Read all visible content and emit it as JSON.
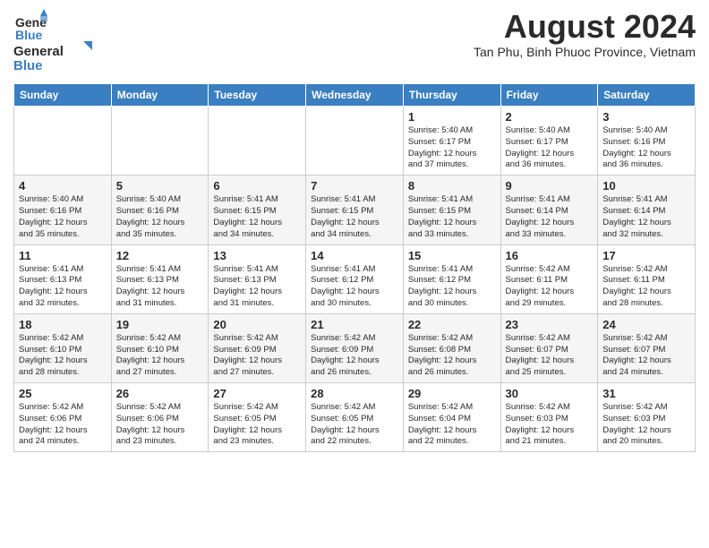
{
  "header": {
    "logo_line1": "General",
    "logo_line2": "Blue",
    "main_title": "August 2024",
    "subtitle": "Tan Phu, Binh Phuoc Province, Vietnam"
  },
  "calendar": {
    "days_of_week": [
      "Sunday",
      "Monday",
      "Tuesday",
      "Wednesday",
      "Thursday",
      "Friday",
      "Saturday"
    ],
    "weeks": [
      [
        {
          "day": "",
          "info": ""
        },
        {
          "day": "",
          "info": ""
        },
        {
          "day": "",
          "info": ""
        },
        {
          "day": "",
          "info": ""
        },
        {
          "day": "1",
          "info": "Sunrise: 5:40 AM\nSunset: 6:17 PM\nDaylight: 12 hours\nand 37 minutes."
        },
        {
          "day": "2",
          "info": "Sunrise: 5:40 AM\nSunset: 6:17 PM\nDaylight: 12 hours\nand 36 minutes."
        },
        {
          "day": "3",
          "info": "Sunrise: 5:40 AM\nSunset: 6:16 PM\nDaylight: 12 hours\nand 36 minutes."
        }
      ],
      [
        {
          "day": "4",
          "info": "Sunrise: 5:40 AM\nSunset: 6:16 PM\nDaylight: 12 hours\nand 35 minutes."
        },
        {
          "day": "5",
          "info": "Sunrise: 5:40 AM\nSunset: 6:16 PM\nDaylight: 12 hours\nand 35 minutes."
        },
        {
          "day": "6",
          "info": "Sunrise: 5:41 AM\nSunset: 6:15 PM\nDaylight: 12 hours\nand 34 minutes."
        },
        {
          "day": "7",
          "info": "Sunrise: 5:41 AM\nSunset: 6:15 PM\nDaylight: 12 hours\nand 34 minutes."
        },
        {
          "day": "8",
          "info": "Sunrise: 5:41 AM\nSunset: 6:15 PM\nDaylight: 12 hours\nand 33 minutes."
        },
        {
          "day": "9",
          "info": "Sunrise: 5:41 AM\nSunset: 6:14 PM\nDaylight: 12 hours\nand 33 minutes."
        },
        {
          "day": "10",
          "info": "Sunrise: 5:41 AM\nSunset: 6:14 PM\nDaylight: 12 hours\nand 32 minutes."
        }
      ],
      [
        {
          "day": "11",
          "info": "Sunrise: 5:41 AM\nSunset: 6:13 PM\nDaylight: 12 hours\nand 32 minutes."
        },
        {
          "day": "12",
          "info": "Sunrise: 5:41 AM\nSunset: 6:13 PM\nDaylight: 12 hours\nand 31 minutes."
        },
        {
          "day": "13",
          "info": "Sunrise: 5:41 AM\nSunset: 6:13 PM\nDaylight: 12 hours\nand 31 minutes."
        },
        {
          "day": "14",
          "info": "Sunrise: 5:41 AM\nSunset: 6:12 PM\nDaylight: 12 hours\nand 30 minutes."
        },
        {
          "day": "15",
          "info": "Sunrise: 5:41 AM\nSunset: 6:12 PM\nDaylight: 12 hours\nand 30 minutes."
        },
        {
          "day": "16",
          "info": "Sunrise: 5:42 AM\nSunset: 6:11 PM\nDaylight: 12 hours\nand 29 minutes."
        },
        {
          "day": "17",
          "info": "Sunrise: 5:42 AM\nSunset: 6:11 PM\nDaylight: 12 hours\nand 28 minutes."
        }
      ],
      [
        {
          "day": "18",
          "info": "Sunrise: 5:42 AM\nSunset: 6:10 PM\nDaylight: 12 hours\nand 28 minutes."
        },
        {
          "day": "19",
          "info": "Sunrise: 5:42 AM\nSunset: 6:10 PM\nDaylight: 12 hours\nand 27 minutes."
        },
        {
          "day": "20",
          "info": "Sunrise: 5:42 AM\nSunset: 6:09 PM\nDaylight: 12 hours\nand 27 minutes."
        },
        {
          "day": "21",
          "info": "Sunrise: 5:42 AM\nSunset: 6:09 PM\nDaylight: 12 hours\nand 26 minutes."
        },
        {
          "day": "22",
          "info": "Sunrise: 5:42 AM\nSunset: 6:08 PM\nDaylight: 12 hours\nand 26 minutes."
        },
        {
          "day": "23",
          "info": "Sunrise: 5:42 AM\nSunset: 6:07 PM\nDaylight: 12 hours\nand 25 minutes."
        },
        {
          "day": "24",
          "info": "Sunrise: 5:42 AM\nSunset: 6:07 PM\nDaylight: 12 hours\nand 24 minutes."
        }
      ],
      [
        {
          "day": "25",
          "info": "Sunrise: 5:42 AM\nSunset: 6:06 PM\nDaylight: 12 hours\nand 24 minutes."
        },
        {
          "day": "26",
          "info": "Sunrise: 5:42 AM\nSunset: 6:06 PM\nDaylight: 12 hours\nand 23 minutes."
        },
        {
          "day": "27",
          "info": "Sunrise: 5:42 AM\nSunset: 6:05 PM\nDaylight: 12 hours\nand 23 minutes."
        },
        {
          "day": "28",
          "info": "Sunrise: 5:42 AM\nSunset: 6:05 PM\nDaylight: 12 hours\nand 22 minutes."
        },
        {
          "day": "29",
          "info": "Sunrise: 5:42 AM\nSunset: 6:04 PM\nDaylight: 12 hours\nand 22 minutes."
        },
        {
          "day": "30",
          "info": "Sunrise: 5:42 AM\nSunset: 6:03 PM\nDaylight: 12 hours\nand 21 minutes."
        },
        {
          "day": "31",
          "info": "Sunrise: 5:42 AM\nSunset: 6:03 PM\nDaylight: 12 hours\nand 20 minutes."
        }
      ]
    ]
  }
}
